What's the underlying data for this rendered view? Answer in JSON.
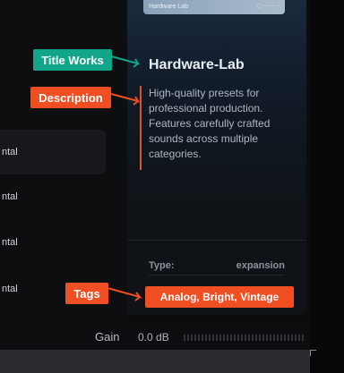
{
  "left_list": [
    {
      "label": "ntal",
      "active": true
    },
    {
      "label": "ntal",
      "active": false
    },
    {
      "label": "ntal",
      "active": false
    },
    {
      "label": "ntal",
      "active": false
    }
  ],
  "card": {
    "thumb_title": "Hardware Lab",
    "title": "Hardware-Lab",
    "description": "High-quality presets for professional production. Features carefully crafted sounds across multiple categories.",
    "type_label": "Type:",
    "type_value": "expansion"
  },
  "tags": "Analog, Bright, Vintage",
  "callouts": {
    "title": "Title Works",
    "description": "Description",
    "tags": "Tags"
  },
  "footer": {
    "gain_label": "Gain",
    "gain_value": "0.0 dB"
  },
  "colors": {
    "teal": "#13a58a",
    "orange": "#f04e23"
  }
}
